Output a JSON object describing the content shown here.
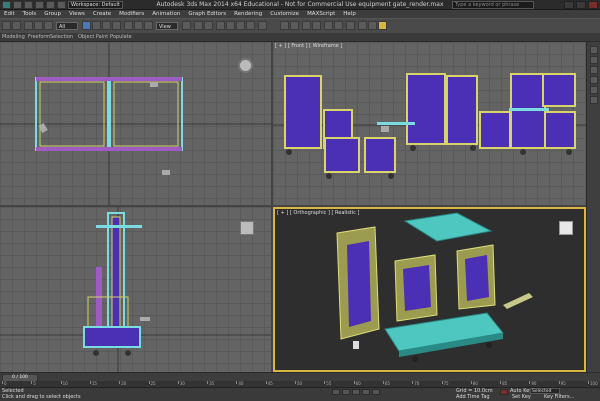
{
  "app": {
    "title": "Autodesk 3ds Max 2014 x64   Educational - Not for Commercial Use    equipment gate_render.max",
    "workspace": "Workspace: Default",
    "search_placeholder": "Type a keyword or phrase"
  },
  "menu": [
    "Edit",
    "Tools",
    "Group",
    "Views",
    "Create",
    "Modifiers",
    "Animation",
    "Graph Editors",
    "Rendering",
    "Customize",
    "MAXScript",
    "Help"
  ],
  "toolbar": {
    "selection_filter": "All",
    "view_dropdown": "View"
  },
  "ribbon": {
    "tabs": [
      "Modeling",
      "Freeform",
      "Selection",
      "Object Paint",
      "Populate"
    ]
  },
  "viewports": {
    "top_left_label": "",
    "top_right_label": "[ + ] [ Front ] [ Wireframe ]",
    "bottom_left_label": "",
    "bottom_right_label": "[ + ] [ Orthographic ] [ Realistic ]"
  },
  "timeslider": {
    "frame": "0 / 100",
    "ticks": [
      "0",
      "5",
      "10",
      "15",
      "20",
      "25",
      "30",
      "35",
      "40",
      "45",
      "50",
      "55",
      "60",
      "65",
      "70",
      "75",
      "80",
      "85",
      "90",
      "95",
      "100"
    ]
  },
  "status": {
    "selection": "Selected",
    "prompt": "Click and drag to select objects",
    "grid": "Grid = 10.0cm",
    "add_time_tag": "Add Time Tag",
    "auto_key": "Auto Key",
    "set_key": "Set Key",
    "selected_dropdown": "Selected",
    "key_filters": "Key Filters..."
  },
  "colors": {
    "accent_yellow": "#d7b740",
    "ui_bg": "#444444",
    "viewport_bg": "#646464",
    "perspective_bg": "#2e2e2e",
    "object_purple": "#4b2fb5",
    "object_yellow": "#b8b85a",
    "object_teal": "#4ec7c0"
  },
  "icons": [
    "app-logo-icon",
    "undo-icon",
    "redo-icon",
    "select-icon",
    "move-icon",
    "rotate-icon",
    "scale-icon",
    "snap-icon",
    "render-icon",
    "viewcube-icon",
    "play-icon",
    "key-icon"
  ]
}
